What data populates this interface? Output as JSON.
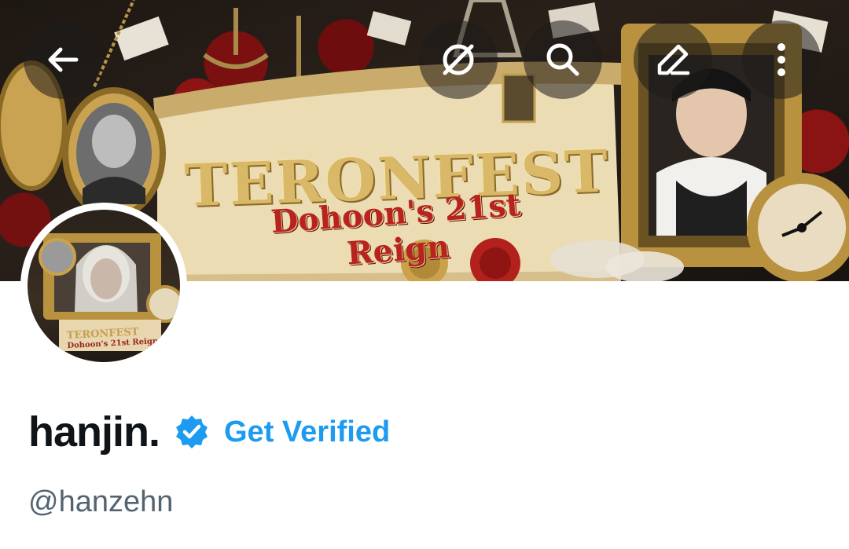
{
  "banner": {
    "title": "TERONFEST",
    "subtitle": "Dohoon's 21st Reign"
  },
  "avatar": {
    "caption_title": "TERONFEST",
    "caption_subtitle": "Dohoon's 21st Reign"
  },
  "nav": {
    "back_icon": "arrow-left-icon",
    "grok_icon": "grok-icon",
    "search_icon": "search-icon",
    "edit_icon": "edit-pencil-icon",
    "more_icon": "more-vertical-icon"
  },
  "profile": {
    "display_name": "hanjin.",
    "get_verified_label": "Get Verified",
    "handle": "@hanzehn"
  },
  "colors": {
    "accent": "#1d9bf0",
    "text_primary": "#0f1419",
    "text_secondary": "#536471"
  }
}
